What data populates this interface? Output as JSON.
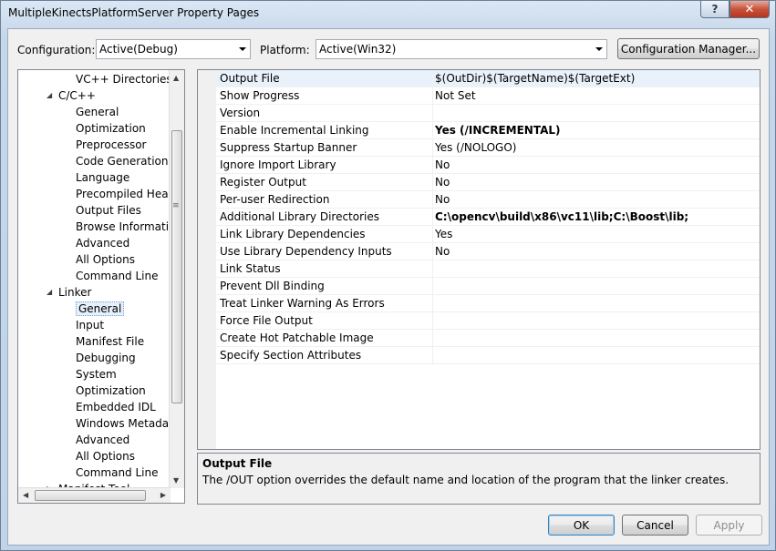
{
  "window": {
    "title": "MultipleKinectsPlatformServer Property Pages",
    "help_label": "?",
    "close_label": "✕"
  },
  "toolbar": {
    "configuration_label": "Configuration:",
    "configuration_value": "Active(Debug)",
    "platform_label": "Platform:",
    "platform_value": "Active(Win32)",
    "config_manager_label": "Configuration Manager..."
  },
  "tree": {
    "items": [
      {
        "label": "VC++ Directories",
        "level": 2
      },
      {
        "label": "C/C++",
        "level": 1,
        "expanded": true
      },
      {
        "label": "General",
        "level": 2
      },
      {
        "label": "Optimization",
        "level": 2
      },
      {
        "label": "Preprocessor",
        "level": 2
      },
      {
        "label": "Code Generation",
        "level": 2
      },
      {
        "label": "Language",
        "level": 2
      },
      {
        "label": "Precompiled Heade",
        "level": 2
      },
      {
        "label": "Output Files",
        "level": 2
      },
      {
        "label": "Browse Information",
        "level": 2
      },
      {
        "label": "Advanced",
        "level": 2
      },
      {
        "label": "All Options",
        "level": 2
      },
      {
        "label": "Command Line",
        "level": 2
      },
      {
        "label": "Linker",
        "level": 1,
        "expanded": true
      },
      {
        "label": "General",
        "level": 2,
        "selected": true
      },
      {
        "label": "Input",
        "level": 2
      },
      {
        "label": "Manifest File",
        "level": 2
      },
      {
        "label": "Debugging",
        "level": 2
      },
      {
        "label": "System",
        "level": 2
      },
      {
        "label": "Optimization",
        "level": 2
      },
      {
        "label": "Embedded IDL",
        "level": 2
      },
      {
        "label": "Windows Metadata",
        "level": 2
      },
      {
        "label": "Advanced",
        "level": 2
      },
      {
        "label": "All Options",
        "level": 2
      },
      {
        "label": "Command Line",
        "level": 2
      },
      {
        "label": "Manifest Tool",
        "level": 1,
        "expanded": false
      }
    ]
  },
  "properties": [
    {
      "name": "Output File",
      "value": "$(OutDir)$(TargetName)$(TargetExt)",
      "bold": false
    },
    {
      "name": "Show Progress",
      "value": "Not Set",
      "bold": false
    },
    {
      "name": "Version",
      "value": "",
      "bold": false
    },
    {
      "name": "Enable Incremental Linking",
      "value": "Yes (/INCREMENTAL)",
      "bold": true
    },
    {
      "name": "Suppress Startup Banner",
      "value": "Yes (/NOLOGO)",
      "bold": false
    },
    {
      "name": "Ignore Import Library",
      "value": "No",
      "bold": false
    },
    {
      "name": "Register Output",
      "value": "No",
      "bold": false
    },
    {
      "name": "Per-user Redirection",
      "value": "No",
      "bold": false
    },
    {
      "name": "Additional Library Directories",
      "value": "C:\\opencv\\build\\x86\\vc11\\lib;C:\\Boost\\lib;",
      "bold": true
    },
    {
      "name": "Link Library Dependencies",
      "value": "Yes",
      "bold": false
    },
    {
      "name": "Use Library Dependency Inputs",
      "value": "No",
      "bold": false
    },
    {
      "name": "Link Status",
      "value": "",
      "bold": false
    },
    {
      "name": "Prevent Dll Binding",
      "value": "",
      "bold": false
    },
    {
      "name": "Treat Linker Warning As Errors",
      "value": "",
      "bold": false
    },
    {
      "name": "Force File Output",
      "value": "",
      "bold": false
    },
    {
      "name": "Create Hot Patchable Image",
      "value": "",
      "bold": false
    },
    {
      "name": "Specify Section Attributes",
      "value": "",
      "bold": false
    }
  ],
  "description": {
    "title": "Output File",
    "text": "The /OUT option overrides the default name and location of the program that the linker creates."
  },
  "buttons": {
    "ok": "OK",
    "cancel": "Cancel",
    "apply": "Apply"
  }
}
